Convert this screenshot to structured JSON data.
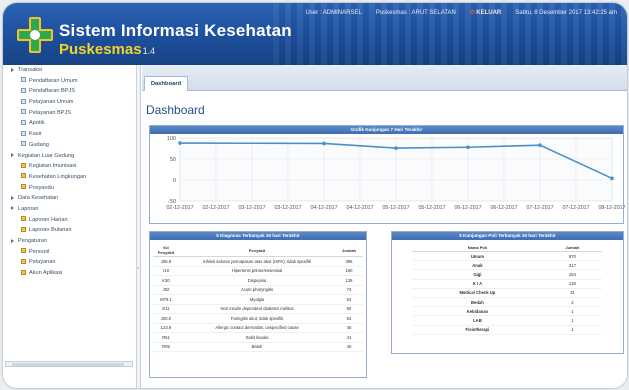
{
  "header": {
    "title": "Sistem Informasi Kesehatan",
    "subtitle": "Puskesmas",
    "version": "1.4",
    "user": "User : ADMINARSEL",
    "location": "Puskesmas : ARUT SELATAN",
    "logout": "KELUAR",
    "datetime": "Sabtu, 8 Desember 2017   13:42:25 am"
  },
  "sidebar": {
    "items": [
      {
        "label": "Transaksi",
        "level": "top",
        "icon": "tri"
      },
      {
        "label": "Pendaftaran Umum",
        "level": "sub",
        "icon": "page"
      },
      {
        "label": "Pendaftaran BPJS",
        "level": "sub",
        "icon": "page"
      },
      {
        "label": "Pelayanan Umum",
        "level": "sub",
        "icon": "page"
      },
      {
        "label": "Pelayanan BPJS",
        "level": "sub",
        "icon": "page"
      },
      {
        "label": "Apotik",
        "level": "sub",
        "icon": "page"
      },
      {
        "label": "Kasir",
        "level": "sub",
        "icon": "page"
      },
      {
        "label": "Gudang",
        "level": "sub",
        "icon": "page"
      },
      {
        "label": "Kegiatan Luar Gedung",
        "level": "top",
        "icon": "tri"
      },
      {
        "label": "Kegiatan Imunisasi",
        "level": "sub",
        "icon": "folder"
      },
      {
        "label": "Kesehatan Lingkungan",
        "level": "sub",
        "icon": "folder"
      },
      {
        "label": "Posyandu",
        "level": "sub",
        "icon": "folder"
      },
      {
        "label": "Data Kesehatan",
        "level": "top",
        "icon": "tri"
      },
      {
        "label": "Laporan",
        "level": "top",
        "icon": "tri"
      },
      {
        "label": "Laporan Harian",
        "level": "sub",
        "icon": "folder"
      },
      {
        "label": "Laporan Bulanan",
        "level": "sub",
        "icon": "folder"
      },
      {
        "label": "Pengaturan",
        "level": "top",
        "icon": "tri"
      },
      {
        "label": "Personil",
        "level": "sub",
        "icon": "folder"
      },
      {
        "label": "Pelayanan",
        "level": "sub",
        "icon": "folder"
      },
      {
        "label": "Akun Aplikasi",
        "level": "sub",
        "icon": "folder"
      }
    ]
  },
  "tabs": [
    {
      "label": "Dashboard"
    }
  ],
  "page_title": "Dashboard",
  "chart_data": {
    "type": "line",
    "title": "Grafik Kunjungan 7 Hari Terakhir",
    "categories": [
      "02-12-2017",
      "02-12-2017",
      "03-12-2017",
      "03-12-2017",
      "04-12-2017",
      "04-12-2017",
      "05-12-2017",
      "05-12-2017",
      "06-12-2017",
      "06-12-2017",
      "07-12-2017",
      "07-12-2017",
      "08-12-2017"
    ],
    "x": [
      0,
      4,
      6,
      8,
      10,
      12
    ],
    "values": [
      88,
      87,
      76,
      78,
      83,
      4
    ],
    "ylim": [
      -50,
      100
    ],
    "yticks": [
      "100",
      "50",
      "0",
      "-50"
    ],
    "grid": true,
    "color": "#4a90c8"
  },
  "diagnosa": {
    "title": "5 Diagnosa Terbanyak 30 hari Terakhir",
    "headers": [
      "Kd Penyakit",
      "Penyakit",
      "Jumlah"
    ],
    "rows": [
      [
        "J06.9",
        "Infeksi saluran pernapasan atas akut (ISPA), tidak spesifik",
        "396"
      ],
      [
        "I10",
        "Hipertensi primer/essensial",
        "190"
      ],
      [
        "K30",
        "Dispepsia",
        "128"
      ],
      [
        "J02",
        "Acute pharyngitis",
        "73"
      ],
      [
        "M79.1",
        "Myalgia",
        "53"
      ],
      [
        "E11",
        "Non insulin dependent diabetes melitus",
        "50"
      ],
      [
        "J00.0",
        "Faringitis akut, tidak spesifik",
        "54"
      ],
      [
        "L23.9",
        "Allergic contact dermatitis, unspecified cause",
        "46"
      ],
      [
        "R51",
        "Sakit kepala",
        "41"
      ],
      [
        "R05",
        "Batuk",
        "40"
      ]
    ]
  },
  "poli": {
    "title": "5 Kunjungan Poli Terbanyak 30 hari Terakhir",
    "headers": [
      "Nama Poli",
      "Jumlah"
    ],
    "rows": [
      [
        "Umum",
        "870"
      ],
      [
        "Anak",
        "317"
      ],
      [
        "Gigi",
        "254"
      ],
      [
        "K I A",
        "130"
      ],
      [
        "Medical Check Up",
        "31"
      ],
      [
        "Bedah",
        "2"
      ],
      [
        "Kebidanan",
        "1"
      ],
      [
        "LAB",
        "1"
      ],
      [
        "Fisiotherapi",
        "1"
      ]
    ]
  }
}
